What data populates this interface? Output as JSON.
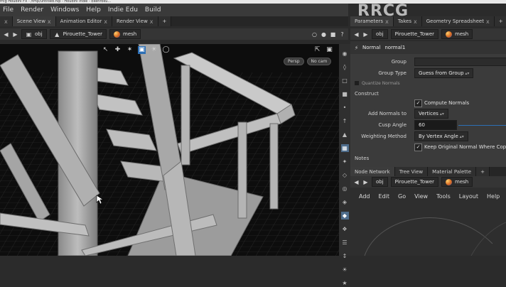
{
  "title_strip": "rrcg Houdini FX - /tmp/untitled.hip - Houdini Indie - Ekenroku...",
  "watermark": "RRCG",
  "menu": [
    "File",
    "Render",
    "Windows",
    "Help",
    "Indie Edu",
    "Build"
  ],
  "left_tabs": {
    "close_all": "x",
    "tabs": [
      {
        "label": "Scene View",
        "close": "x"
      },
      {
        "label": "Animation Editor",
        "close": "x"
      },
      {
        "label": "Render View",
        "close": "x"
      }
    ],
    "add": "+"
  },
  "left_path": {
    "network": "obj",
    "object": "Pirouette_Tower",
    "node": "mesh"
  },
  "viewport": {
    "tools": [
      "select",
      "transform",
      "handle",
      "camera",
      "light",
      "display"
    ],
    "nav": [
      "Persp",
      "No cam"
    ]
  },
  "sidebar_tools": [
    "visible",
    "ghost",
    "wire",
    "shaded",
    "points",
    "normals",
    "hull",
    "grid",
    "snap",
    "lock",
    "camera",
    "render",
    "info",
    "handle",
    "align",
    "measure",
    "light",
    "fx"
  ],
  "right_tabs": {
    "tabs": [
      {
        "label": "Parameters",
        "close": "x"
      },
      {
        "label": "Takes",
        "close": "x"
      },
      {
        "label": "Geometry Spreadsheet",
        "close": "x"
      }
    ],
    "add": "+"
  },
  "right_path": {
    "network": "obj",
    "object": "Pirouette_Tower",
    "node": "mesh"
  },
  "node": {
    "type": "Normal",
    "name": "normal1"
  },
  "params": {
    "group_label": "Group",
    "group_type_label": "Group Type",
    "group_type_value": "Guess from Group",
    "quantize_label": "Quantize Normals",
    "construct_section": "Construct",
    "compute_normals_label": "Compute Normals",
    "add_normals_label": "Add Normals to",
    "add_normals_value": "Vertices",
    "cusp_angle_label": "Cusp Angle",
    "cusp_angle_value": "60",
    "weighting_label": "Weighting Method",
    "weighting_value": "By Vertex Angle",
    "keep_flat_label": "Keep Original Normal Where Coplanar",
    "notes_section": "Notes"
  },
  "net_tabs": {
    "tabs": [
      "Node Network",
      "Tree View",
      "Material Palette"
    ],
    "add": "+"
  },
  "net_path": {
    "network": "obj",
    "object": "Pirouette_Tower",
    "node": "mesh"
  },
  "net_menu": [
    "Add",
    "Edit",
    "Go",
    "View",
    "Tools",
    "Layout",
    "Help"
  ],
  "colors": {
    "accent": "#2d6fb5",
    "panel": "#3b3b3b",
    "viewport_bg": "#111111"
  }
}
